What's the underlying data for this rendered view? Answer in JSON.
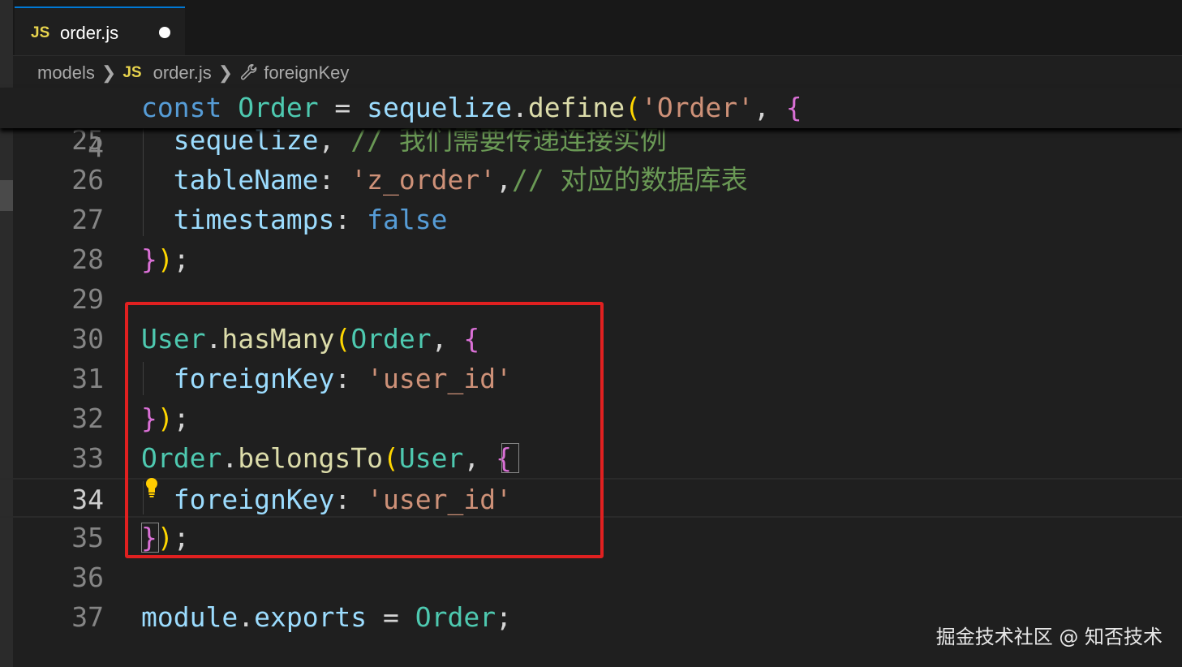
{
  "tab": {
    "icon": "JS",
    "name": "order.js",
    "modified_indicator": "unsaved-dot"
  },
  "breadcrumb": {
    "folder": "models",
    "file_icon": "JS",
    "file": "order.js",
    "symbol_icon": "wrench-icon",
    "symbol": "foreignKey"
  },
  "sticky_line": {
    "number": "4",
    "tokens": [
      {
        "t": "const",
        "c": "kw"
      },
      {
        "t": " ",
        "c": "op"
      },
      {
        "t": "Order",
        "c": "cls"
      },
      {
        "t": " = ",
        "c": "op"
      },
      {
        "t": "sequelize",
        "c": "var"
      },
      {
        "t": ".",
        "c": "op"
      },
      {
        "t": "define",
        "c": "fn"
      },
      {
        "t": "(",
        "c": "p1"
      },
      {
        "t": "'Order'",
        "c": "str"
      },
      {
        "t": ", ",
        "c": "op"
      },
      {
        "t": "{",
        "c": "p2"
      }
    ]
  },
  "lines": [
    {
      "number": "25",
      "tokens": [
        {
          "t": "  sequelize",
          "c": "var"
        },
        {
          "t": ", ",
          "c": "op"
        },
        {
          "t": "// 我们需要传递连接实例",
          "c": "cmt"
        }
      ]
    },
    {
      "number": "26",
      "tokens": [
        {
          "t": "  tableName",
          "c": "var"
        },
        {
          "t": ": ",
          "c": "op"
        },
        {
          "t": "'z_order'",
          "c": "str"
        },
        {
          "t": ",",
          "c": "op"
        },
        {
          "t": "// 对应的数据库表",
          "c": "cmt"
        }
      ]
    },
    {
      "number": "27",
      "tokens": [
        {
          "t": "  timestamps",
          "c": "var"
        },
        {
          "t": ": ",
          "c": "op"
        },
        {
          "t": "false",
          "c": "kw"
        }
      ]
    },
    {
      "number": "28",
      "tokens": [
        {
          "t": "}",
          "c": "p2"
        },
        {
          "t": ")",
          "c": "p1"
        },
        {
          "t": ";",
          "c": "op"
        }
      ]
    },
    {
      "number": "29",
      "tokens": []
    },
    {
      "number": "30",
      "tokens": [
        {
          "t": "User",
          "c": "cls"
        },
        {
          "t": ".",
          "c": "op"
        },
        {
          "t": "hasMany",
          "c": "fn"
        },
        {
          "t": "(",
          "c": "p1"
        },
        {
          "t": "Order",
          "c": "cls"
        },
        {
          "t": ", ",
          "c": "op"
        },
        {
          "t": "{",
          "c": "p2"
        }
      ]
    },
    {
      "number": "31",
      "tokens": [
        {
          "t": "  foreignKey",
          "c": "var"
        },
        {
          "t": ": ",
          "c": "op"
        },
        {
          "t": "'user_id'",
          "c": "str"
        }
      ]
    },
    {
      "number": "32",
      "tokens": [
        {
          "t": "}",
          "c": "p2"
        },
        {
          "t": ")",
          "c": "p1"
        },
        {
          "t": ";",
          "c": "op"
        }
      ]
    },
    {
      "number": "33",
      "tokens": [
        {
          "t": "Order",
          "c": "cls"
        },
        {
          "t": ".",
          "c": "op"
        },
        {
          "t": "belongsTo",
          "c": "fn"
        },
        {
          "t": "(",
          "c": "p1"
        },
        {
          "t": "User",
          "c": "cls"
        },
        {
          "t": ", ",
          "c": "op"
        },
        {
          "t": "{",
          "c": "p2"
        }
      ]
    },
    {
      "number": "34",
      "active": true,
      "tokens": [
        {
          "t": "  foreignKey",
          "c": "var"
        },
        {
          "t": ": ",
          "c": "op"
        },
        {
          "t": "'user_id'",
          "c": "str"
        }
      ]
    },
    {
      "number": "35",
      "tokens": [
        {
          "t": "}",
          "c": "p2"
        },
        {
          "t": ")",
          "c": "p1"
        },
        {
          "t": ";",
          "c": "op"
        }
      ]
    },
    {
      "number": "36",
      "tokens": []
    },
    {
      "number": "37",
      "tokens": [
        {
          "t": "module",
          "c": "var"
        },
        {
          "t": ".",
          "c": "op"
        },
        {
          "t": "exports",
          "c": "var"
        },
        {
          "t": " = ",
          "c": "op"
        },
        {
          "t": "Order",
          "c": "cls"
        },
        {
          "t": ";",
          "c": "op"
        }
      ]
    }
  ],
  "lightbulb_icon": "lightbulb-icon",
  "watermark": "掘金技术社区 @ 知否技术",
  "colors": {
    "keyword": "#569cd6",
    "class": "#4ec9b0",
    "variable": "#9cdcfe",
    "function": "#dcdcaa",
    "string": "#ce9178",
    "comment": "#6a9955",
    "bracket_level1": "#ffd700",
    "bracket_level2": "#da70d6",
    "highlight_box": "#e02020",
    "tab_accent": "#0078d4"
  }
}
